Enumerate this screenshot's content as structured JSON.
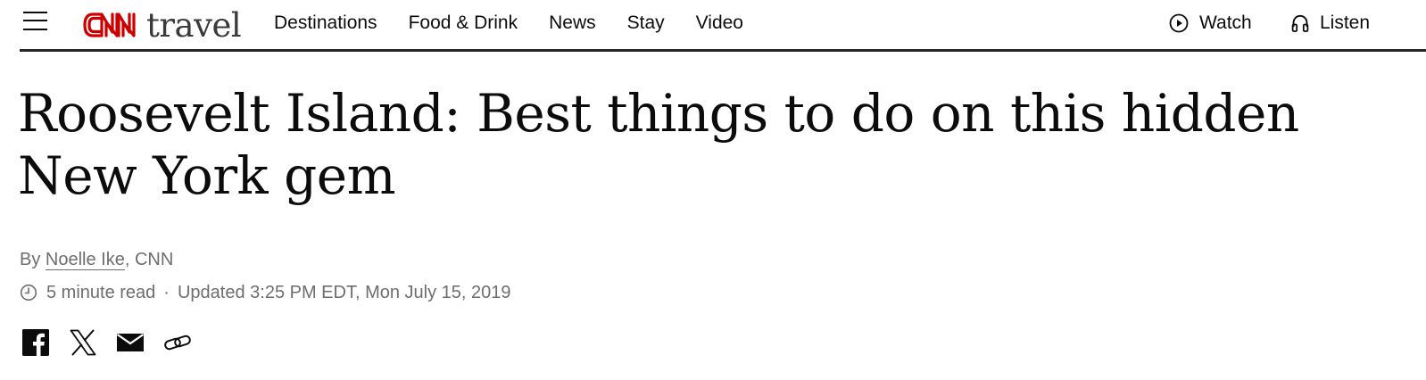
{
  "header": {
    "logo": {
      "brand": "CNN",
      "section": "travel",
      "brand_color": "#cc0000"
    },
    "nav": [
      {
        "label": "Destinations"
      },
      {
        "label": "Food & Drink"
      },
      {
        "label": "News"
      },
      {
        "label": "Stay"
      },
      {
        "label": "Video"
      }
    ],
    "watch_label": "Watch",
    "listen_label": "Listen",
    "icons": {
      "menu": "hamburger-menu-icon",
      "watch": "play-circle-icon",
      "listen": "headphones-icon"
    }
  },
  "article": {
    "headline": "Roosevelt Island: Best things to do on this hidden New York gem",
    "byline": {
      "prefix": "By",
      "author": "Noelle Ike",
      "outlet": ", CNN"
    },
    "meta": {
      "read_time": "5 minute read",
      "separator": "·",
      "updated": "Updated 3:25 PM EDT, Mon July 15, 2019"
    },
    "share": [
      {
        "name": "facebook",
        "icon": "facebook-icon"
      },
      {
        "name": "x",
        "icon": "x-twitter-icon"
      },
      {
        "name": "email",
        "icon": "email-icon"
      },
      {
        "name": "copy-link",
        "icon": "link-icon"
      }
    ]
  },
  "colors": {
    "text": "#0c0c0c",
    "muted": "#6e6e6e",
    "divider": "#262626",
    "cnn_red": "#cc0000"
  }
}
